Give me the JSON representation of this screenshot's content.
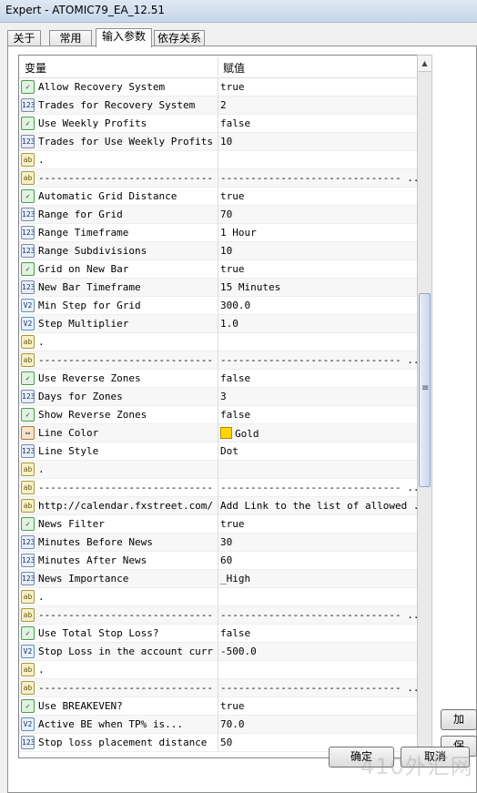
{
  "window": {
    "title": "Expert - ATOMIC79_EA_12.51"
  },
  "tabs": [
    {
      "label": "关于",
      "active": false
    },
    {
      "label": "常用",
      "active": false
    },
    {
      "label": "输入参数",
      "active": true
    },
    {
      "label": "依存关系",
      "active": false
    }
  ],
  "grid": {
    "header": {
      "name": "变量",
      "value": "赋值"
    },
    "rows": [
      {
        "type": "bool",
        "icon": "bool-icon",
        "name": "Allow Recovery System",
        "value": "true"
      },
      {
        "type": "int",
        "icon": "int-icon",
        "name": "Trades for Recovery System",
        "value": "2"
      },
      {
        "type": "bool",
        "icon": "bool-icon",
        "name": "Use Weekly Profits",
        "value": "false"
      },
      {
        "type": "int",
        "icon": "int-icon",
        "name": "Trades for Use Weekly Profits",
        "value": "10"
      },
      {
        "type": "str",
        "icon": "string-icon",
        "name": ".",
        "value": ""
      },
      {
        "type": "str",
        "icon": "string-icon",
        "name": "------------------------------...",
        "value": "------------------------------   ..."
      },
      {
        "type": "bool",
        "icon": "bool-icon",
        "name": "Automatic Grid Distance",
        "value": "true"
      },
      {
        "type": "int",
        "icon": "int-icon",
        "name": "Range for Grid",
        "value": "70"
      },
      {
        "type": "enum",
        "icon": "enum-icon",
        "name": "Range Timeframe",
        "value": "1 Hour"
      },
      {
        "type": "int",
        "icon": "int-icon",
        "name": "Range Subdivisions",
        "value": "10"
      },
      {
        "type": "bool",
        "icon": "bool-icon",
        "name": "Grid on New Bar",
        "value": "true"
      },
      {
        "type": "enum",
        "icon": "enum-icon",
        "name": "New Bar Timeframe",
        "value": "15 Minutes"
      },
      {
        "type": "dbl",
        "icon": "double-icon",
        "name": "Min Step for Grid",
        "value": "300.0"
      },
      {
        "type": "dbl",
        "icon": "double-icon",
        "name": "Step Multiplier",
        "value": "1.0"
      },
      {
        "type": "str",
        "icon": "string-icon",
        "name": ".",
        "value": ""
      },
      {
        "type": "str",
        "icon": "string-icon",
        "name": "------------------------------...",
        "value": "------------------------------   ..."
      },
      {
        "type": "bool",
        "icon": "bool-icon",
        "name": "Use Reverse Zones",
        "value": "false"
      },
      {
        "type": "int",
        "icon": "int-icon",
        "name": "Days for Zones",
        "value": "3"
      },
      {
        "type": "bool",
        "icon": "bool-icon",
        "name": "Show Reverse Zones",
        "value": "false"
      },
      {
        "type": "color",
        "icon": "color-icon",
        "name": "Line Color",
        "value": "Gold",
        "swatch": "#ffd700"
      },
      {
        "type": "enum",
        "icon": "enum-icon",
        "name": "Line Style",
        "value": "Dot"
      },
      {
        "type": "str",
        "icon": "string-icon",
        "name": ".",
        "value": ""
      },
      {
        "type": "str",
        "icon": "string-icon",
        "name": "------------------------------...",
        "value": "------------------------------   ..."
      },
      {
        "type": "str",
        "icon": "string-icon",
        "name": "http://calendar.fxstreet.com/",
        "value": "Add Link to the list of allowed ..."
      },
      {
        "type": "bool",
        "icon": "bool-icon",
        "name": "News Filter",
        "value": "true"
      },
      {
        "type": "int",
        "icon": "int-icon",
        "name": "Minutes Before News",
        "value": "30"
      },
      {
        "type": "int",
        "icon": "int-icon",
        "name": "Minutes After News",
        "value": "60"
      },
      {
        "type": "enum",
        "icon": "enum-icon",
        "name": "News Importance",
        "value": "_High"
      },
      {
        "type": "str",
        "icon": "string-icon",
        "name": ".",
        "value": ""
      },
      {
        "type": "str",
        "icon": "string-icon",
        "name": "------------------------------...",
        "value": "------------------------------   ..."
      },
      {
        "type": "bool",
        "icon": "bool-icon",
        "name": "Use Total Stop Loss?",
        "value": "false"
      },
      {
        "type": "dbl",
        "icon": "double-icon",
        "name": "Stop Loss in the account curr...",
        "value": "-500.0"
      },
      {
        "type": "str",
        "icon": "string-icon",
        "name": ".",
        "value": ""
      },
      {
        "type": "str",
        "icon": "string-icon",
        "name": "------------------------------...",
        "value": "------------------------------   ..."
      },
      {
        "type": "bool",
        "icon": "bool-icon",
        "name": "Use BREAKEVEN?",
        "value": "true"
      },
      {
        "type": "dbl",
        "icon": "double-icon",
        "name": "Active BE when TP% is...",
        "value": "70.0"
      },
      {
        "type": "int",
        "icon": "int-icon",
        "name": "Stop loss placement distance",
        "value": "50"
      }
    ]
  },
  "icon_glyphs": {
    "bool": "✓",
    "int": "123",
    "dbl": "V2",
    "str": "ab",
    "color": "▭",
    "enum": "123"
  },
  "buttons": {
    "load": "加",
    "save": "保",
    "ok": "确定",
    "cancel": "取消"
  },
  "watermark": "410外汇网"
}
